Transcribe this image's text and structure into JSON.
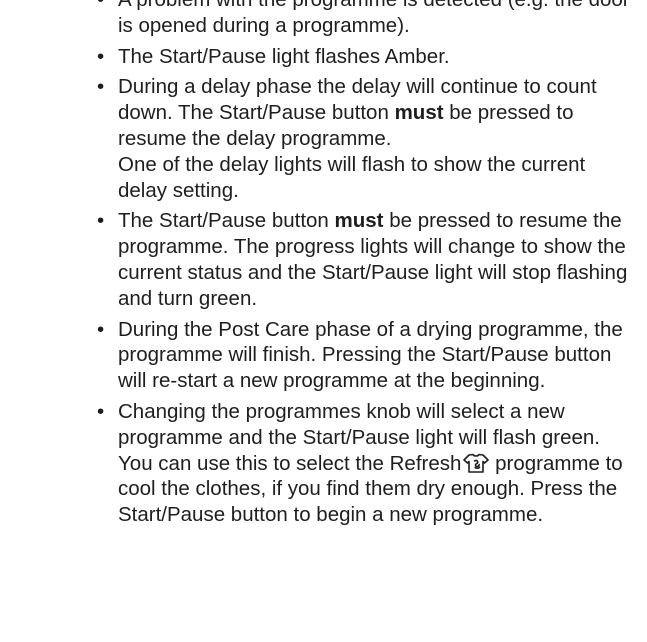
{
  "items": [
    {
      "text": "A problem with the programme is detected (e.g. the door is opened during a programme)."
    },
    {
      "text": "The Start/Pause light flashes Amber."
    },
    {
      "text": "During a delay phase the delay will continue to count down. The Start/Pause button ",
      "bold": "must",
      "text2": " be pressed to resume the delay programme.",
      "text3": "One of the delay lights will flash to show the current delay setting."
    },
    {
      "text": "The Start/Pause button ",
      "bold": "must",
      "text2": " be pressed to resume the programme. The progress lights will change to show the current status and the Start/Pause light will stop flashing and turn green."
    },
    {
      "text": "During the Post Care phase of a drying programme, the programme will finish. Pressing the Start/Pause button will re-start a new programme at the beginning."
    },
    {
      "text": "Changing the programmes knob will select a new programme and the Start/Pause light will flash green. You can use this to select the Refresh",
      "icon": "refresh-shirt-icon",
      "text2": " programme to cool the clothes, if you find them dry enough. Press the Start/Pause button to begin a new programme."
    }
  ]
}
